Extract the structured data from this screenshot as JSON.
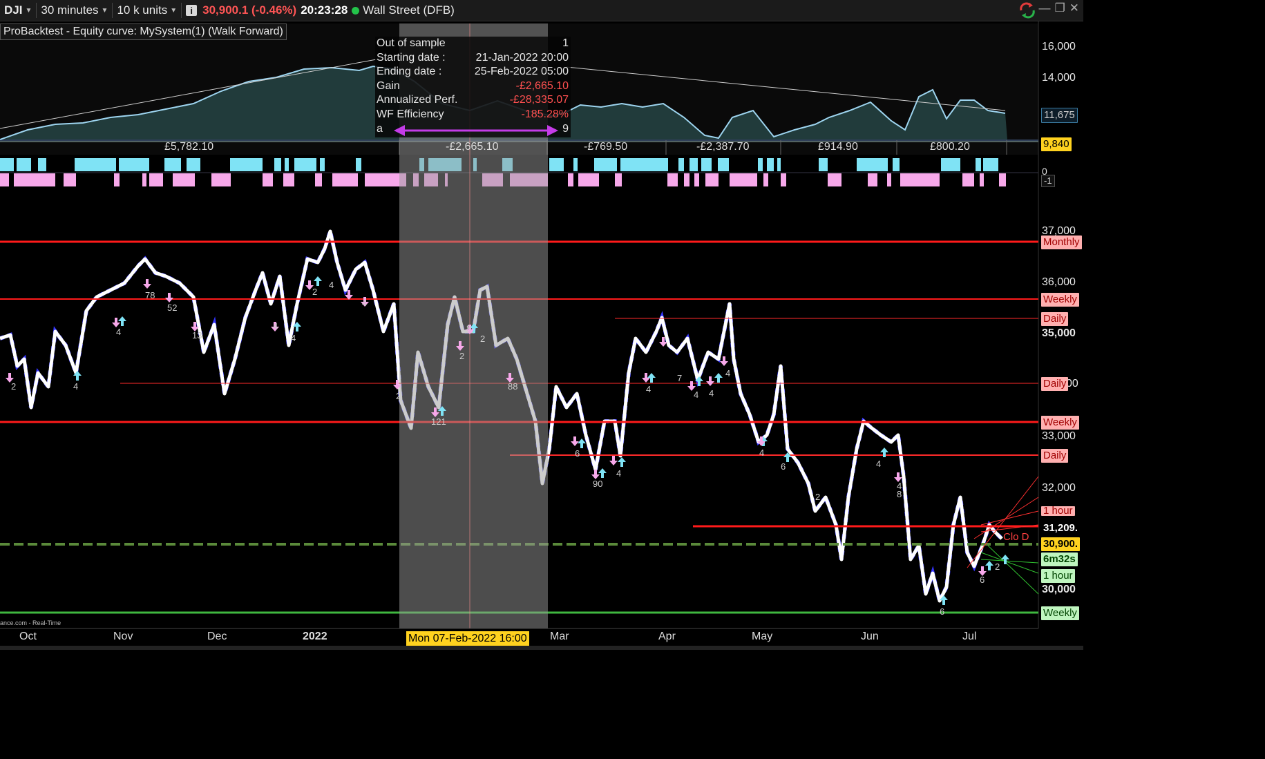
{
  "toolbar": {
    "instrument": "DJI",
    "timeframe": "30 minutes",
    "units": "10 k units",
    "price": "30,900.1 (-0.46%)",
    "time": "20:23:28",
    "market": "Wall Street (DFB)"
  },
  "panel_title": "ProBacktest - Equity curve: MySystem(1) (Walk Forward)",
  "oos_box": {
    "title": "Out of sample",
    "index": "1",
    "start_label": "Starting date :",
    "start_value": "21-Jan-2022 20:00",
    "end_label": "Ending date :",
    "end_value": "25-Feb-2022 05:00",
    "gain_label": "Gain",
    "gain_value": "-£2,665.10",
    "ann_label": "Annualized Perf.",
    "ann_value": "-£28,335.07",
    "wf_label": "WF Efficiency",
    "wf_value": "-185.28%",
    "a_label": "a",
    "nine": "9"
  },
  "period_gains": [
    "£5,782.10",
    "-£2,665.10",
    "-£769.50",
    "-£2,387.70",
    "£914.90",
    "£800.20"
  ],
  "equity_axis": [
    "16,000",
    "14,000",
    "11,675",
    "9,840"
  ],
  "signal_axis": [
    "0",
    "-1"
  ],
  "price_axis": [
    "37,000",
    "36,000",
    "35,000",
    "00",
    "33,000",
    "32,000",
    "31,209.",
    "30,900.",
    "6m32s",
    "30,000"
  ],
  "levels": [
    "Monthly",
    "Weekly",
    "Daily",
    "Daily",
    "Weekly",
    "Daily",
    "1 hour",
    "1 hour",
    "Weekly"
  ],
  "clo_label": "Clo D",
  "months": [
    "Oct",
    "Nov",
    "Dec",
    "2022",
    "Mar",
    "Apr",
    "May",
    "Jun",
    "Jul"
  ],
  "crosshair_date": "Mon 07-Feb-2022 16:00",
  "source": "ance.com - Real-Time",
  "trade_labels": [
    "2",
    "4",
    "78",
    "52",
    "4",
    "13",
    "2",
    "4",
    "4",
    "4",
    "4",
    "2",
    "2",
    "121",
    "2",
    "8",
    "88",
    "6",
    "90",
    "4",
    "4",
    "7",
    "4",
    "4",
    "4",
    "4",
    "6",
    "4",
    "2",
    "4",
    "8",
    "6",
    "2",
    "6"
  ],
  "colors": {
    "accent_red": "#ff2020",
    "cyan": "#7fe3f5",
    "pink": "#f7a8ea",
    "green_level": "#3fb83f"
  }
}
